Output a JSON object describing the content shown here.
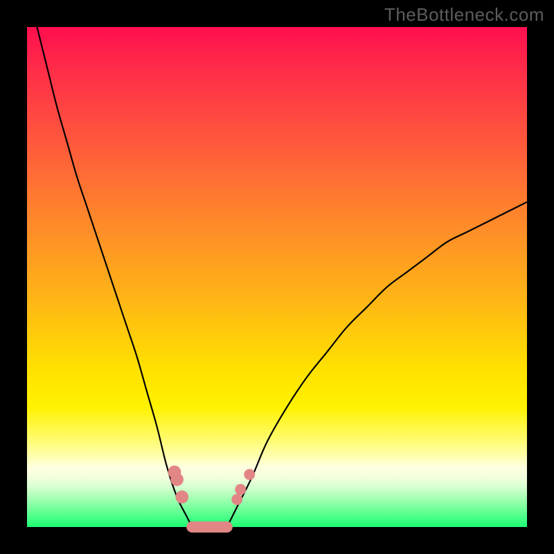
{
  "watermark": "TheBottleneck.com",
  "chart_data": {
    "type": "line",
    "title": "",
    "xlabel": "",
    "ylabel": "",
    "xlim": [
      0,
      100
    ],
    "ylim": [
      0,
      100
    ],
    "grid": false,
    "legend": false,
    "background_gradient": {
      "direction": "vertical",
      "stops": [
        {
          "pos": 0.0,
          "color": "#ff0e4f"
        },
        {
          "pos": 0.25,
          "color": "#ff5e3a"
        },
        {
          "pos": 0.55,
          "color": "#ffb715"
        },
        {
          "pos": 0.76,
          "color": "#fff200"
        },
        {
          "pos": 0.88,
          "color": "#ffffe0"
        },
        {
          "pos": 1.0,
          "color": "#1dff72"
        }
      ]
    },
    "series": [
      {
        "name": "left-curve",
        "color": "#000000",
        "x": [
          2,
          4,
          6,
          8,
          10,
          12,
          14,
          16,
          18,
          20,
          22,
          24,
          26,
          28,
          30,
          32,
          33
        ],
        "y": [
          100,
          92,
          84,
          77,
          70,
          64,
          58,
          52,
          46,
          40,
          34,
          27,
          20,
          12,
          6,
          2,
          0
        ]
      },
      {
        "name": "right-curve",
        "color": "#000000",
        "x": [
          40,
          42,
          45,
          48,
          52,
          56,
          60,
          64,
          68,
          72,
          76,
          80,
          84,
          88,
          92,
          96,
          100
        ],
        "y": [
          0,
          4,
          10,
          17,
          24,
          30,
          35,
          40,
          44,
          48,
          51,
          54,
          57,
          59,
          61,
          63,
          65
        ]
      },
      {
        "name": "valley-floor",
        "color": "#e28585",
        "x": [
          33,
          34,
          36,
          38,
          40
        ],
        "y": [
          0,
          0,
          0,
          0,
          0
        ]
      }
    ],
    "markers": [
      {
        "name": "left-dot-1",
        "x": 29.5,
        "y": 11.0,
        "r": 1.3,
        "color": "#e28585"
      },
      {
        "name": "left-dot-2",
        "x": 30.0,
        "y": 9.5,
        "r": 1.3,
        "color": "#e28585"
      },
      {
        "name": "left-dot-3",
        "x": 31.0,
        "y": 6.0,
        "r": 1.3,
        "color": "#e28585"
      },
      {
        "name": "right-dot-1",
        "x": 42.0,
        "y": 5.5,
        "r": 1.1,
        "color": "#e28585"
      },
      {
        "name": "right-dot-2",
        "x": 42.7,
        "y": 7.5,
        "r": 1.1,
        "color": "#e28585"
      },
      {
        "name": "right-dot-3",
        "x": 44.5,
        "y": 10.5,
        "r": 1.1,
        "color": "#e28585"
      }
    ]
  }
}
